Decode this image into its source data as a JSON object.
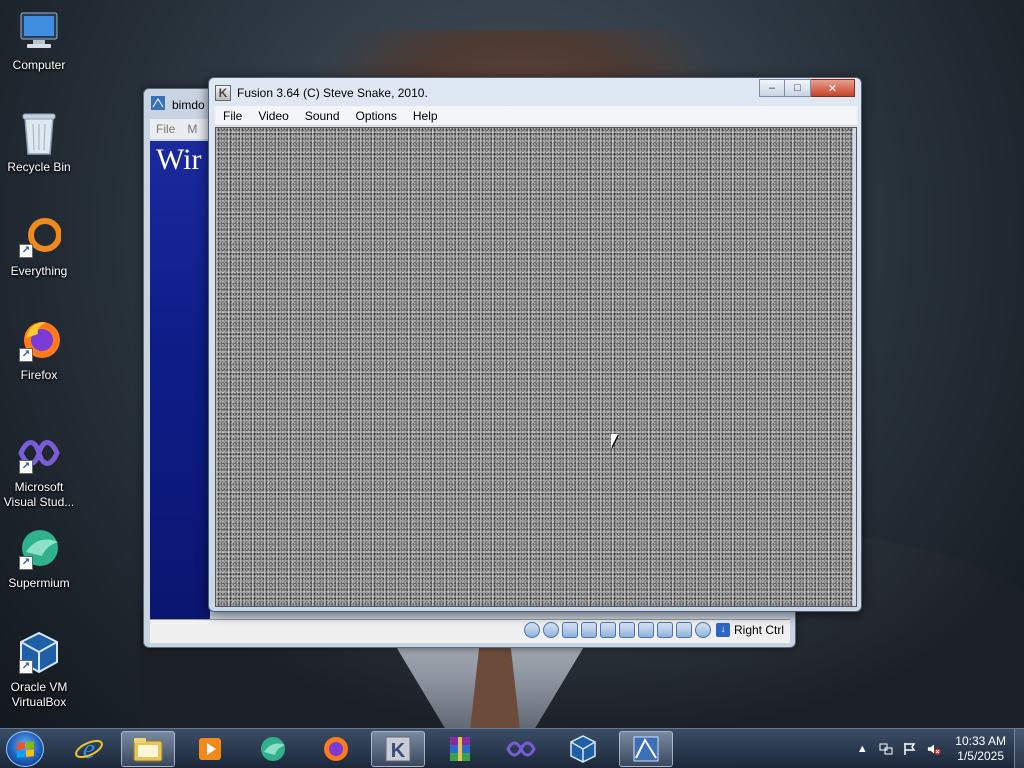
{
  "desktop": {
    "icons": [
      {
        "label": "Computer",
        "icon": "computer-icon"
      },
      {
        "label": "Recycle Bin",
        "icon": "recycle-bin-icon"
      },
      {
        "label": "Everything",
        "icon": "everything-icon"
      },
      {
        "label": "Firefox",
        "icon": "firefox-icon"
      },
      {
        "label": "Microsoft Visual Stud...",
        "icon": "visual-studio-icon"
      },
      {
        "label": "Supermium",
        "icon": "supermium-icon"
      },
      {
        "label": "Oracle VM VirtualBox",
        "icon": "virtualbox-icon"
      }
    ]
  },
  "vbox_window": {
    "title": "bimdo",
    "menu": [
      "File",
      "M"
    ],
    "screen_text": "Wir",
    "host_key": "Right Ctrl"
  },
  "fusion_window": {
    "title": "Fusion 3.64 (C) Steve Snake, 2010.",
    "menu": [
      "File",
      "Video",
      "Sound",
      "Options",
      "Help"
    ],
    "caption_buttons": {
      "minimize": "‒",
      "maximize": "□",
      "close": "✕"
    }
  },
  "taskbar": {
    "items": [
      {
        "icon": "internet-explorer-icon"
      },
      {
        "icon": "file-explorer-icon"
      },
      {
        "icon": "media-player-icon"
      },
      {
        "icon": "supermium-icon"
      },
      {
        "icon": "firefox-icon"
      },
      {
        "icon": "fusion-icon",
        "active": true
      },
      {
        "icon": "winrar-icon"
      },
      {
        "icon": "visual-studio-icon"
      },
      {
        "icon": "virtualbox-icon"
      },
      {
        "icon": "virtualbox-vm-icon",
        "active": true
      }
    ],
    "clock_time": "10:33 AM",
    "clock_date": "1/5/2025"
  },
  "colors": {
    "taskbar": "#26374d",
    "fusion_frame": "#c9d7e6",
    "vm_screen": "#0f1d8a",
    "close_button": "#c7432a"
  }
}
